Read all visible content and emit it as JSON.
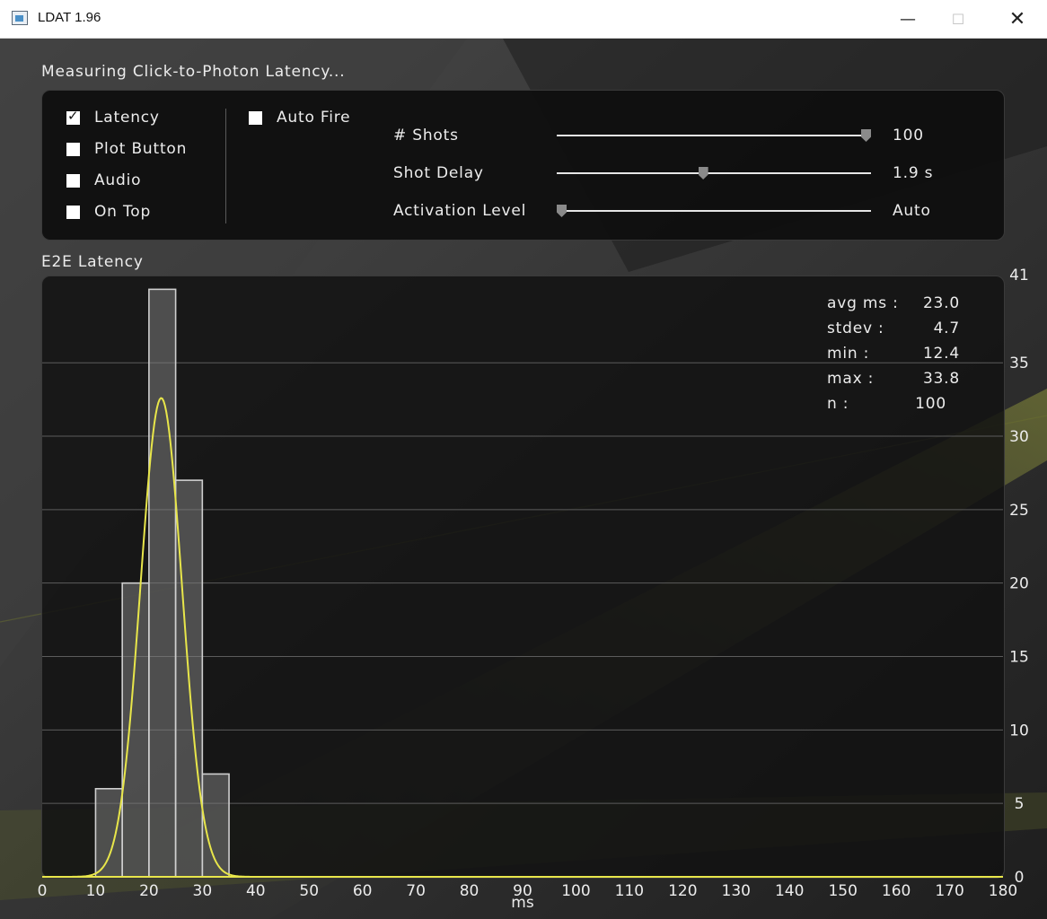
{
  "window": {
    "title": "LDAT 1.96",
    "icon": "app-icon",
    "controls": {
      "minimize": "—",
      "maximize": "☐",
      "close": "✕"
    }
  },
  "status": {
    "text": "Measuring  Click-to-Photon  Latency..."
  },
  "options": {
    "checkboxes": [
      {
        "label": "Latency",
        "checked": true
      },
      {
        "label": "Plot  Button",
        "checked": false
      },
      {
        "label": "Audio",
        "checked": false
      },
      {
        "label": "On  Top",
        "checked": false
      }
    ],
    "auto_fire": {
      "label": "Auto  Fire",
      "checked": false
    }
  },
  "sliders": [
    {
      "label": "#  Shots",
      "value": "100",
      "level": 1.0
    },
    {
      "label": "Shot  Delay",
      "value": "1.9  s",
      "level": 0.465
    },
    {
      "label": "Activation  Level",
      "value": "Auto",
      "level": 0.0
    }
  ],
  "plot": {
    "title": "E2E  Latency",
    "stats": [
      {
        "label": "avg  ms  :",
        "value": "23.0"
      },
      {
        "label": "stdev  :",
        "value": "4.7"
      },
      {
        "label": "min  :",
        "value": "12.4"
      },
      {
        "label": "max  :",
        "value": "33.8"
      },
      {
        "label": "n  :",
        "value": "100"
      }
    ]
  },
  "chart_data": {
    "type": "bar",
    "title": "E2E  Latency",
    "xlabel": "ms",
    "ylabel": "",
    "xlim": [
      0,
      180
    ],
    "ylim": [
      0,
      41
    ],
    "x_ticks": [
      0,
      10,
      20,
      30,
      40,
      50,
      60,
      70,
      80,
      90,
      100,
      110,
      120,
      130,
      140,
      150,
      160,
      170,
      180
    ],
    "y_ticks": [
      0,
      5,
      10,
      15,
      20,
      25,
      30,
      35,
      41
    ],
    "grid": true,
    "series": [
      {
        "type": "histogram",
        "bin_width": 5,
        "bins": [
          {
            "start": 10,
            "end": 15,
            "count": 6
          },
          {
            "start": 15,
            "end": 20,
            "count": 20
          },
          {
            "start": 20,
            "end": 25,
            "count": 40
          },
          {
            "start": 25,
            "end": 30,
            "count": 27
          },
          {
            "start": 30,
            "end": 35,
            "count": 7
          }
        ],
        "color": "#cfcfcf"
      },
      {
        "type": "line",
        "curve": "normal-fit",
        "mean": 22.3,
        "stdev": 3.9,
        "peak": 32.6,
        "color": "#e8e64a"
      }
    ]
  }
}
